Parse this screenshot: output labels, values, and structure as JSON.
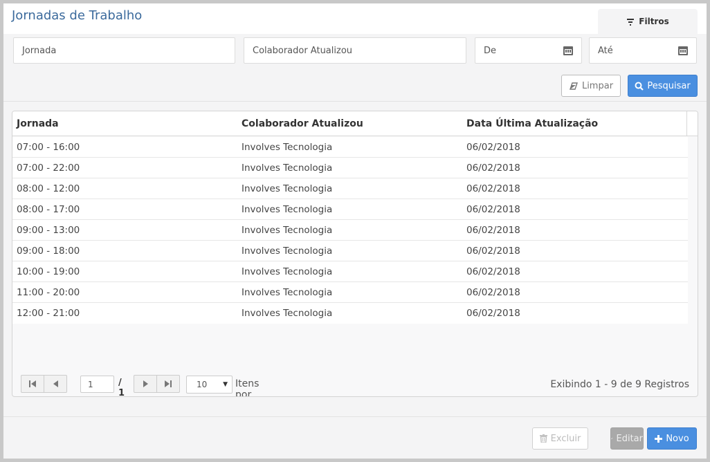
{
  "header": {
    "title": "Jornadas de Trabalho",
    "filters_tab": "Filtros"
  },
  "filters": {
    "jornada_placeholder": "Jornada",
    "colaborador_placeholder": "Colaborador Atualizou",
    "de_placeholder": "De",
    "ate_placeholder": "Até",
    "limpar_label": "Limpar",
    "pesquisar_label": "Pesquisar"
  },
  "table": {
    "columns": [
      "Jornada",
      "Colaborador Atualizou",
      "Data Última Atualização"
    ],
    "rows": [
      [
        "07:00 - 16:00",
        "Involves Tecnologia",
        "06/02/2018"
      ],
      [
        "07:00 - 22:00",
        "Involves Tecnologia",
        "06/02/2018"
      ],
      [
        "08:00 - 12:00",
        "Involves Tecnologia",
        "06/02/2018"
      ],
      [
        "08:00 - 17:00",
        "Involves Tecnologia",
        "06/02/2018"
      ],
      [
        "09:00 - 13:00",
        "Involves Tecnologia",
        "06/02/2018"
      ],
      [
        "09:00 - 18:00",
        "Involves Tecnologia",
        "06/02/2018"
      ],
      [
        "10:00 - 19:00",
        "Involves Tecnologia",
        "06/02/2018"
      ],
      [
        "11:00 - 20:00",
        "Involves Tecnologia",
        "06/02/2018"
      ],
      [
        "12:00 - 21:00",
        "Involves Tecnologia",
        "06/02/2018"
      ]
    ]
  },
  "pagination": {
    "current_page": "1",
    "total_pages": "/ 1",
    "per_page": "10",
    "per_page_label": "Itens por página",
    "records_text": "Exibindo 1 - 9 de 9 Registros"
  },
  "actions": {
    "excluir_label": "Excluir",
    "editar_label": "Editar",
    "novo_label": "Novo"
  },
  "colors": {
    "accent": "#4a8fe0",
    "title": "#3b6a9c",
    "disabled": "#a9a9a9"
  },
  "icons": {
    "filter": "filter-icon",
    "calendar": "calendar-icon",
    "eraser": "eraser-icon",
    "search": "search-icon",
    "trash": "trash-icon",
    "pencil": "pencil-icon",
    "plus": "plus-icon"
  }
}
